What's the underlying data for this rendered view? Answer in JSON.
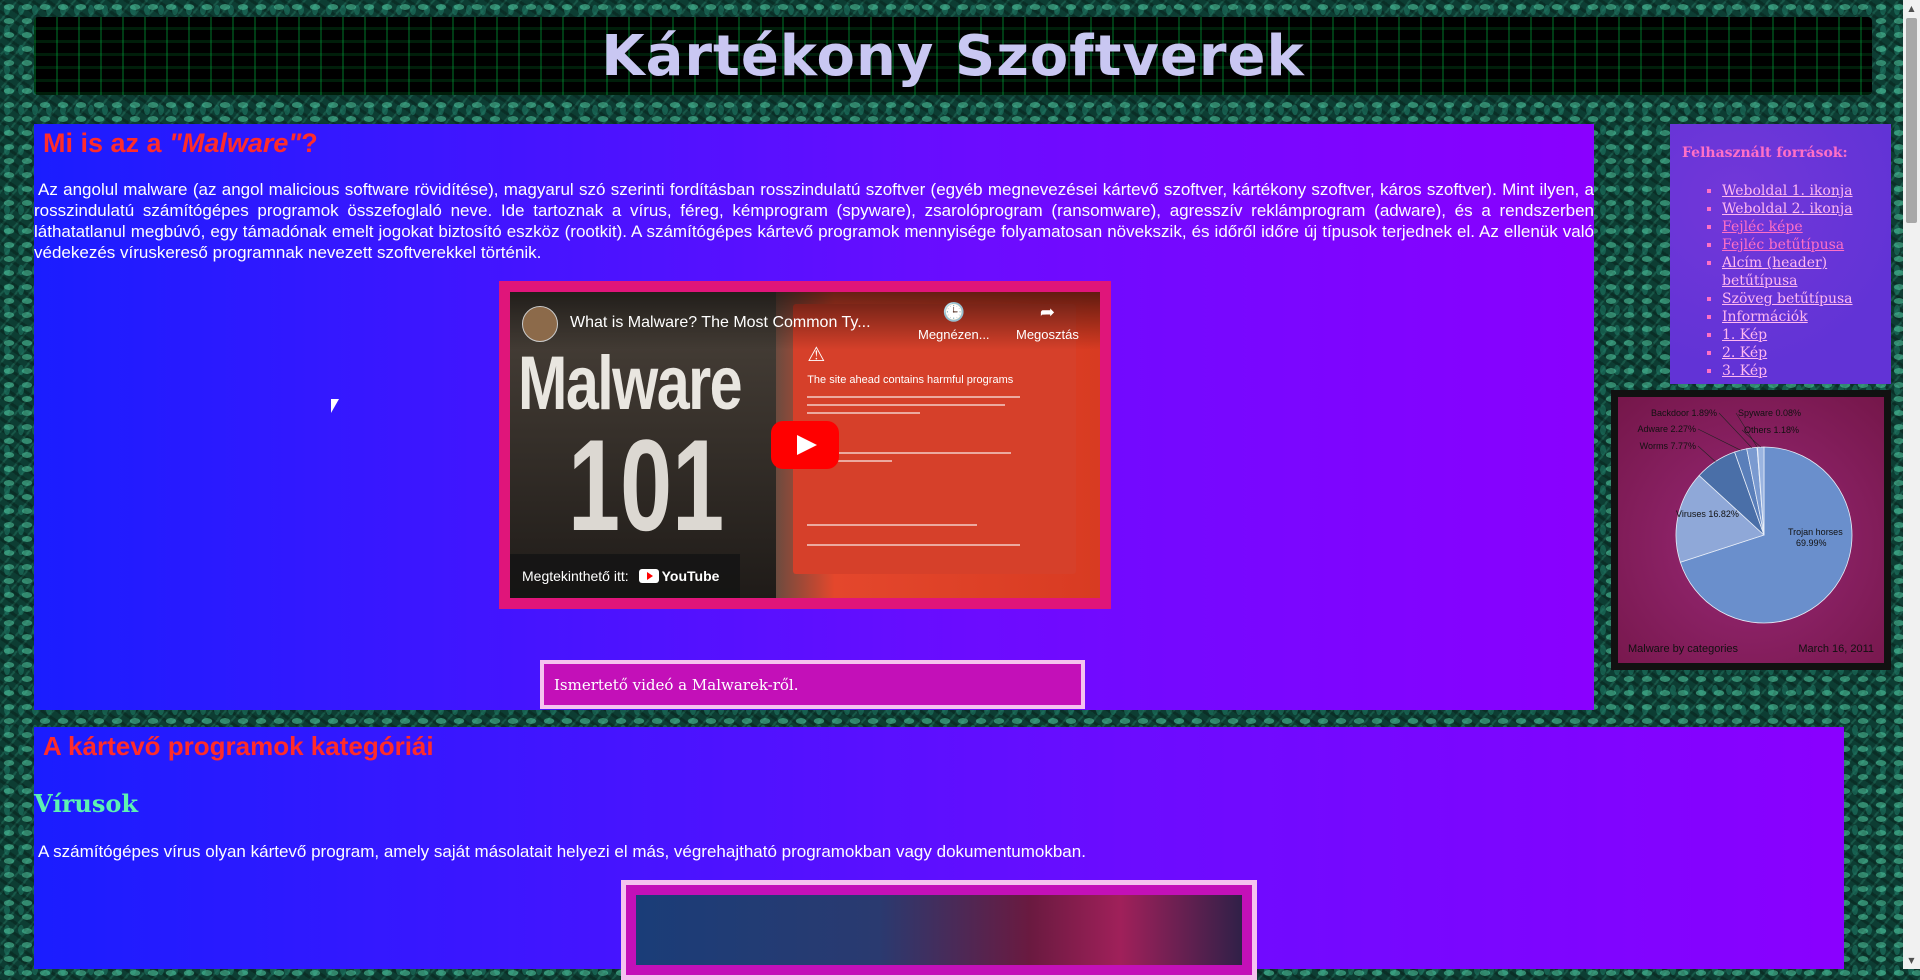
{
  "header": {
    "title": "Kártékony Szoftverek"
  },
  "intro_section": {
    "title_prefix": "Mi is az a ",
    "title_emph": "\"Malware\"",
    "title_suffix": "?",
    "paragraph": "Az angolul malware (az angol malicious software rövidítése), magyarul szó szerinti fordításban rosszindulatú szoftver (egyéb megnevezései kártevő szoftver, kártékony szoftver, káros szoftver). Mint ilyen, a rosszindulatú számítógépes programok összefoglaló neve. Ide tartoznak a vírus, féreg, kémprogram (spyware), zsarolóprogram (ransomware), agresszív reklámprogram (adware), és a rendszerben láthatatlanul megbúvó, egy támadónak emelt jogokat biztosító eszköz (rootkit). A számítógépes kártevő programok mennyisége folyamatosan növekszik, és időről időre új típusok terjednek el. Az ellenük való védekezés víruskereső programnak nevezett szoftverekkel történik."
  },
  "video": {
    "title": "What is Malware? The Most Common Ty...",
    "watch_later": "Megnézen...",
    "share": "Megosztás",
    "big_text_1": "Malware",
    "big_text_2": "101",
    "screen_heading": "The site ahead contains harmful programs",
    "watch_on": "Megtekinthető itt:",
    "yt_label": "YouTube",
    "caption": "Ismertető videó a Malwarek-ről."
  },
  "sources": {
    "title": "Felhasznált források:",
    "items": [
      "Weboldal 1. ikonja",
      "Weboldal 2. ikonja",
      "Fejléc képe",
      "Fejléc betűtípusa",
      "Alcím (header) betűtípusa",
      "Szöveg betűtípusa",
      "Információk",
      "1. Kép",
      "2. Kép",
      "3. Kép"
    ]
  },
  "chart_data": {
    "type": "pie",
    "title": "",
    "labels": [
      "Trojan horses",
      "Viruses",
      "Worms",
      "Adware",
      "Backdoor",
      "Spyware",
      "Others"
    ],
    "values": [
      69.99,
      16.82,
      7.77,
      2.27,
      1.89,
      0.08,
      1.18
    ],
    "value_labels": [
      "Trojan horses 69.99%",
      "Viruses 16.82%",
      "Worms 7.77%",
      "Adware 2.27%",
      "Backdoor 1.89%",
      "Spyware 0.08%",
      "Others 1.18%"
    ],
    "colors": [
      "#6a8fcc",
      "#8fa8d8",
      "#4a6fa8",
      "#5a7fba",
      "#7a9ad0",
      "#3f5f98",
      "#9ab4e0"
    ],
    "footer_left": "Malware by categories",
    "footer_right": "March 16, 2011"
  },
  "categories_section": {
    "title": "A kártevő programok kategóriái",
    "subtitle": "Vírusok",
    "text": "A számítógépes vírus olyan kártevő program, amely saját másolatait helyezi el más, végrehajtható programokban vagy dokumentumokban."
  }
}
